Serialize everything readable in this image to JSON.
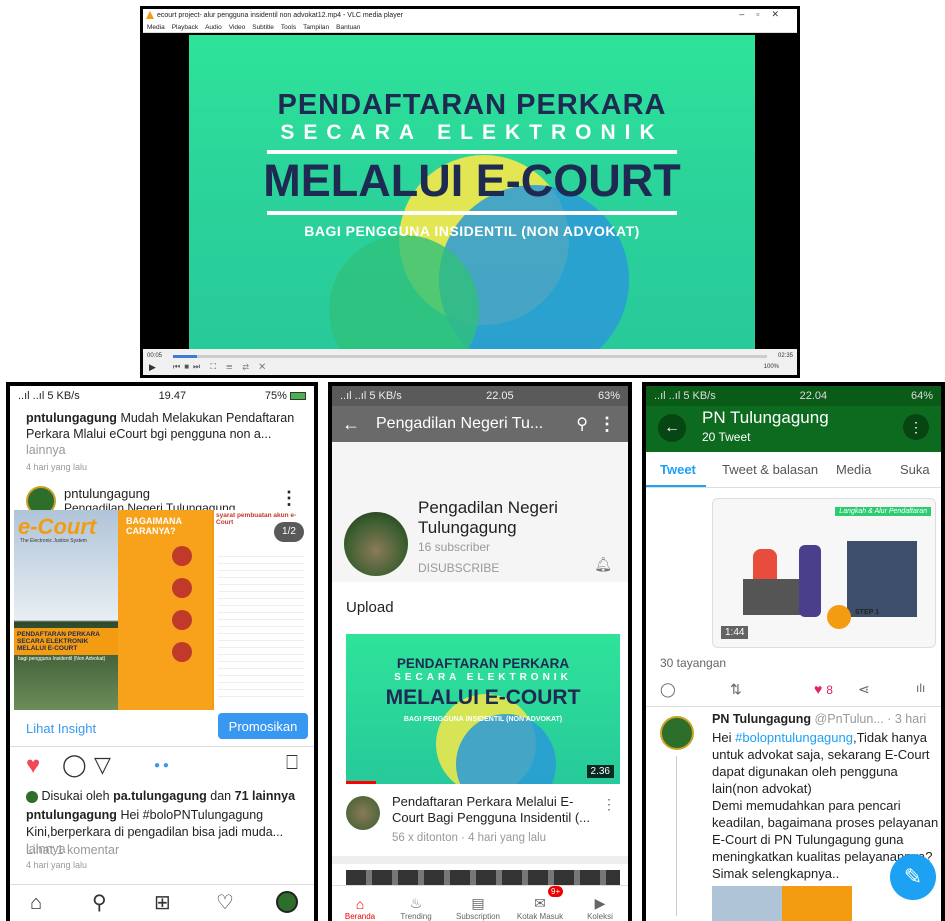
{
  "vlc": {
    "window_title": "ecourt project- alur pengguna insidentil non advokat12.mp4 - VLC media player",
    "menu": [
      "Media",
      "Playback",
      "Audio",
      "Video",
      "Subtitle",
      "Tools",
      "Tampilan",
      "Bantuan"
    ],
    "video": {
      "line1": "PENDAFTARAN PERKARA",
      "line2": "SECARA ELEKTRONIK",
      "line3": "MELALUI E-COURT",
      "line4": "BAGI PENGGUNA INSIDENTIL (NON ADVOKAT)"
    },
    "time_elapsed": "00:05",
    "time_total": "02:35",
    "progress": 0.04,
    "volume": "100%"
  },
  "instagram": {
    "status": {
      "signal": "..ıl ..ıl 5 KB/s",
      "time": "19.47",
      "battery": "75%"
    },
    "prev_post": {
      "username": "pntulungagung",
      "caption": "Mudah Melakukan Pendaftaran Perkara Mlalui eCourt bgi pengguna non a...",
      "more": "lainnya",
      "time": "4 hari yang lalu"
    },
    "post": {
      "username": "pntulungagung",
      "location": "Pengadilan Negeri Tulungagung",
      "image": {
        "brand": "e-Court",
        "brand_sub": "The Electronic Justice System",
        "middle_title": "BAGAIMANA CARANYA?",
        "right_title": "syarat pembuatan akun e-Court",
        "counter": "1/2",
        "left_title": "PENDAFTARAN PERKARA SECARA ELEKTRONIK MELALUI E-COURT",
        "left_sub": "bagi pengguna Insidentil (Non Advokat)"
      },
      "insight_label": "Lihat Insight",
      "promote_label": "Promosikan",
      "liked_by_prefix": "Disukai oleh",
      "liked_by_user": "pa.tulungagung",
      "liked_by_mid": "dan",
      "liked_by_count": "71 lainnya",
      "caption_user": "pntulungagung",
      "caption": "Hei #boloPNTulungagung",
      "caption2": "Kini,berperkara di pengadilan bisa jadi muda...",
      "more": "lainnya",
      "comments": "Lihat 1 komentar",
      "time": "4 hari yang lalu"
    }
  },
  "youtube": {
    "status": {
      "signal": "..ıl ..ıl 5 KB/s",
      "time": "22.05",
      "battery": "63%"
    },
    "header_title": "Pengadilan Negeri Tu...",
    "channel_name": "Pengadilan Negeri Tulungagung",
    "subscribers": "16 subscriber",
    "subscribe_state": "DISUBSCRIBE",
    "section": "Upload",
    "thumb": {
      "line1": "PENDAFTARAN PERKARA",
      "line2": "SECARA ELEKTRONIK",
      "line3": "MELALUI E-COURT",
      "line4": "BAGI PENGGUNA INSIDENTIL (NON ADVOKAT)",
      "duration": "2.36"
    },
    "video_title": "Pendaftaran Perkara Melalui E-Court Bagi Pengguna Insidentil (...",
    "video_meta": "56 x ditonton · 4 hari yang lalu",
    "tabs": [
      "Beranda",
      "Trending",
      "Subscription",
      "Kotak Masuk",
      "Koleksi"
    ],
    "inbox_badge": "9+"
  },
  "twitter": {
    "status": {
      "signal": "..ıl ..ıl 5 KB/s",
      "time": "22.04",
      "battery": "64%"
    },
    "header_title": "PN Tulungagung",
    "tweet_count": "20 Tweet",
    "tabs": [
      "Tweet",
      "Tweet & balasan",
      "Media",
      "Suka"
    ],
    "media": {
      "duration": "1:44",
      "banner": "Langkah & Alur Pendaftaran",
      "step": "STEP 1"
    },
    "views": "30 tayangan",
    "likes": "8",
    "tweet": {
      "name": "PN Tulungagung",
      "handle": "@PnTulun...",
      "time": "· 3 hari",
      "hashtag": "#bolopntulungagung",
      "text1": ",Tidak hanya untuk advokat saja, sekarang E-Court dapat digunakan oleh pengguna lain(non advokat)",
      "text2": "Demi memudahkan para pencari keadilan, bagaimana proses pelayanan E-Court di PN Tulungagung guna meningkatkan kualitas pelayanannya? Simak selengkapnya..",
      "prefix": "Hei "
    },
    "colors": {
      "header": "#0c6b1e",
      "accent": "#1da1f2"
    }
  }
}
